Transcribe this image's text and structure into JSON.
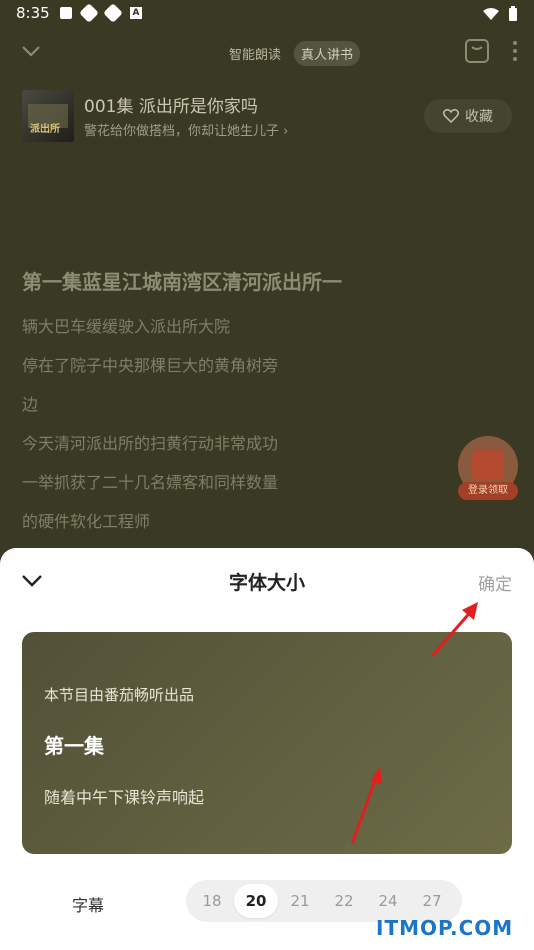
{
  "status_bar": {
    "time": "8:35",
    "badge_letter": "A"
  },
  "top_bar": {
    "mode_tabs": [
      {
        "label": "智能朗读",
        "active": false
      },
      {
        "label": "真人讲书",
        "active": true
      }
    ]
  },
  "book": {
    "cover_text": "派出所",
    "title": "001集 派出所是你家吗",
    "subtitle": "警花给你做搭档，你却让她生儿子 ›",
    "favorite_label": "收藏"
  },
  "content": {
    "heading": "第一集蓝星江城南湾区清河派出所一",
    "lines": [
      "辆大巴车缓缓驶入派出所大院",
      "停在了院子中央那棵巨大的黄角树旁",
      "边",
      "今天清河派出所的扫黄行动非常成功",
      "一举抓获了二十几名嫖客和同样数量",
      "的硬件软化工程师"
    ]
  },
  "floating_badge": {
    "label": "登录领取"
  },
  "sheet": {
    "title": "字体大小",
    "confirm_label": "确定",
    "preview": {
      "line1": "本节目由番茄畅听出品",
      "title": "第一集",
      "line2": "随着中午下课铃声响起"
    },
    "subtitle_label": "字幕",
    "size_options": [
      "18",
      "20",
      "21",
      "22",
      "24",
      "27"
    ],
    "selected_size": "20"
  },
  "watermark": "ITMOP.COM",
  "colors": {
    "overlay_bg": "#3a3924",
    "sheet_bg": "#ffffff",
    "accent_arrow": "#e02020",
    "watermark": "#1b76c8"
  }
}
